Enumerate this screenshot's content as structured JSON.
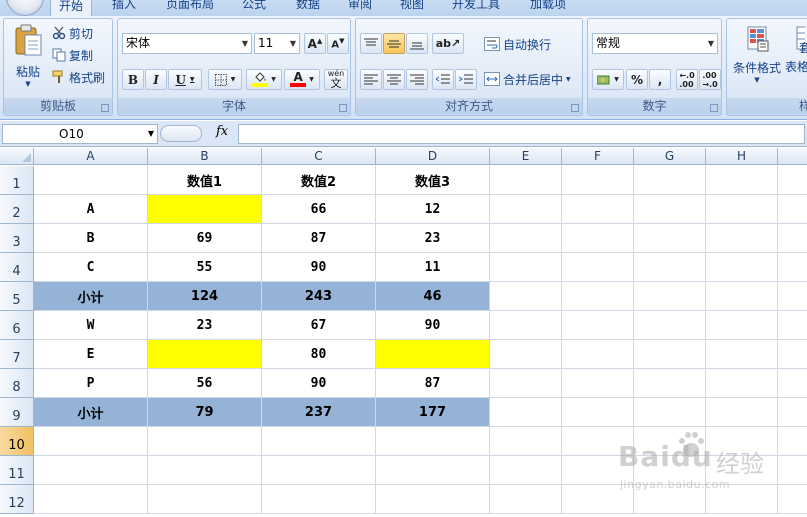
{
  "tabs": [
    "开始",
    "插入",
    "页面布局",
    "公式",
    "数据",
    "审阅",
    "视图",
    "开发工具",
    "加载项"
  ],
  "clipboard": {
    "paste_label": "粘贴",
    "cut_label": "剪切",
    "copy_label": "复制",
    "format_painter_label": "格式刷",
    "group_label": "剪贴板"
  },
  "font": {
    "family": "宋体",
    "size": "11",
    "bold": "B",
    "italic": "I",
    "underline": "U",
    "font_color_glyph": "A",
    "phonetic_glyph": "wén",
    "group_label": "字体",
    "fill_color": "#ffff00",
    "font_color": "#ff0000"
  },
  "alignment": {
    "wrap_label": "自动换行",
    "merge_label": "合并后居中",
    "group_label": "对齐方式"
  },
  "number": {
    "format": "常规",
    "percent": "%",
    "comma": ",",
    "group_label": "数字"
  },
  "styles": {
    "conditional_label": "条件格式",
    "table_label_partial": "套",
    "table_label_partial2": "表格",
    "group_label_partial": "样"
  },
  "formula_bar": {
    "name_box": "O10",
    "fx": "fx",
    "formula": ""
  },
  "columns": [
    "A",
    "B",
    "C",
    "D",
    "E",
    "F",
    "G",
    "H"
  ],
  "rows": [
    "1",
    "2",
    "3",
    "4",
    "5",
    "6",
    "7",
    "8",
    "9",
    "10",
    "11",
    "12"
  ],
  "selected_row": "10",
  "cells": {
    "r1": [
      "",
      "数值1",
      "数值2",
      "数值3"
    ],
    "r2": [
      "A",
      "",
      "66",
      "12"
    ],
    "r3": [
      "B",
      "69",
      "87",
      "23"
    ],
    "r4": [
      "C",
      "55",
      "90",
      "11"
    ],
    "r5": [
      "小计",
      "124",
      "243",
      "46"
    ],
    "r6": [
      "W",
      "23",
      "67",
      "90"
    ],
    "r7": [
      "E",
      "",
      "80",
      ""
    ],
    "r8": [
      "P",
      "56",
      "90",
      "87"
    ],
    "r9": [
      "小计",
      "79",
      "237",
      "177"
    ]
  },
  "colors": {
    "highlight_yellow": "#ffff00",
    "subtotal_blue": "#95b3d7",
    "selected_row_header": "#f1c15f"
  },
  "watermark": {
    "brand": "Baidu",
    "cn": "经验",
    "url": "jingyan.baidu.com"
  }
}
